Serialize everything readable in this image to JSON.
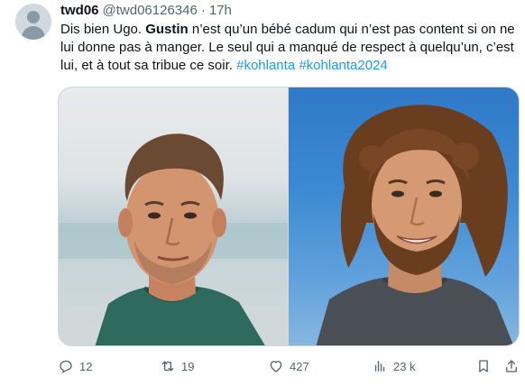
{
  "tweet": {
    "author": {
      "display_name": "twd06",
      "handle": "@twd06126346",
      "separator": "·",
      "time": "17h"
    },
    "text": {
      "part1": "Dis bien Ugo. ",
      "bold": "Gustin",
      "part2": " n’est qu’un bébé cadum qui n’est pas content si on ne lui donne pas à manger. Le seul qui a manqué de respect à quelqu’un, c’est lui, et à tout sa tribue ce soir. ",
      "hashtag1": "#kohlanta",
      "hashtag2": "#kohlanta2024"
    },
    "media": {
      "images": [
        {
          "subject": "man-short-hair-green-shirt",
          "background": "beach-sky"
        },
        {
          "subject": "man-curly-hair-gray-shirt",
          "background": "blue-sky"
        }
      ]
    },
    "actions": {
      "reply_count": "12",
      "retweet_count": "19",
      "like_count": "427",
      "views_count": "23 k"
    }
  },
  "colors": {
    "text": "#0f1419",
    "secondary": "#536471",
    "link": "#1d9bf0",
    "border": "#cfd9de"
  }
}
